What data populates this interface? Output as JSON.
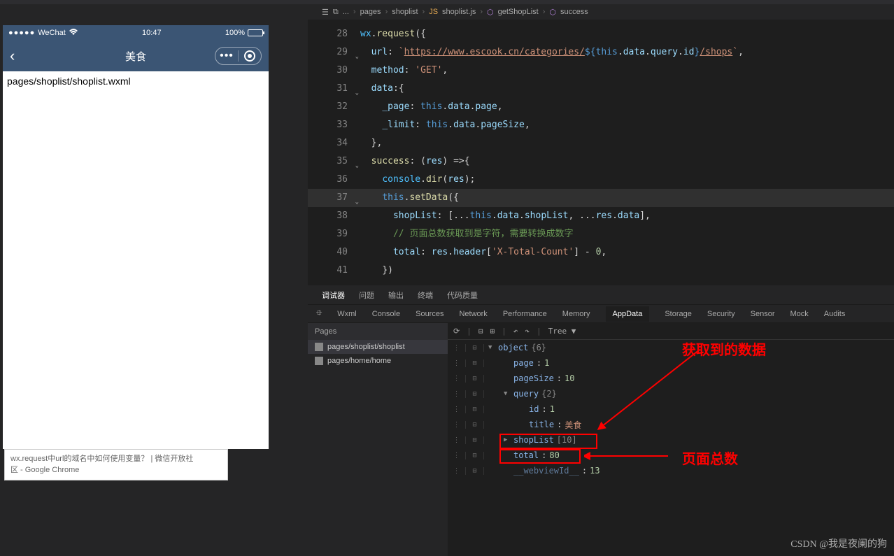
{
  "simulator": {
    "carrier_dots": "●●●●●",
    "carrier": "WeChat",
    "wifi_icon": "wifi",
    "time": "10:47",
    "battery_pct": "100%",
    "page_title": "美食",
    "body_text": "pages/shoplist/shoplist.wxml"
  },
  "browser_tab": {
    "line1": "wx.request中url的域名中如何使用变量？ | 微信开放社",
    "line2": "区 - Google Chrome"
  },
  "breadcrumb": {
    "items": [
      "...",
      "pages",
      "shoplist",
      "shoplist.js",
      "getShopList",
      "success"
    ]
  },
  "code_lines": [
    {
      "n": "28",
      "fold": "",
      "html": "<span class='tk-obj'>wx</span><span class='tk-punc'>.</span><span class='tk-fn'>request</span><span class='tk-punc'>({</span>"
    },
    {
      "n": "29",
      "fold": "v",
      "html": "  <span class='tk-prop'>url</span><span class='tk-punc'>: </span><span class='tk-str'>`</span><span class='tk-strlink'>https://www.escook.cn/categories/</span><span class='tk-tpl'>${</span><span class='tk-kw'>this</span><span class='tk-punc'>.</span><span class='tk-var'>data</span><span class='tk-punc'>.</span><span class='tk-var'>query</span><span class='tk-punc'>.</span><span class='tk-var'>id</span><span class='tk-tpl'>}</span><span class='tk-strlink'>/shops</span><span class='tk-str'>`</span><span class='tk-punc'>,</span>"
    },
    {
      "n": "30",
      "fold": "",
      "html": "  <span class='tk-prop'>method</span><span class='tk-punc'>: </span><span class='tk-str'>'GET'</span><span class='tk-punc'>,</span>"
    },
    {
      "n": "31",
      "fold": "v",
      "html": "  <span class='tk-prop'>data</span><span class='tk-punc'>:{</span>"
    },
    {
      "n": "32",
      "fold": "",
      "html": "    <span class='tk-prop'>_page</span><span class='tk-punc'>: </span><span class='tk-kw'>this</span><span class='tk-punc'>.</span><span class='tk-var'>data</span><span class='tk-punc'>.</span><span class='tk-var'>page</span><span class='tk-punc'>,</span>"
    },
    {
      "n": "33",
      "fold": "",
      "html": "    <span class='tk-prop'>_limit</span><span class='tk-punc'>: </span><span class='tk-kw'>this</span><span class='tk-punc'>.</span><span class='tk-var'>data</span><span class='tk-punc'>.</span><span class='tk-var'>pageSize</span><span class='tk-punc'>,</span>"
    },
    {
      "n": "34",
      "fold": "",
      "html": "  <span class='tk-punc'>},</span>"
    },
    {
      "n": "35",
      "fold": "v",
      "html": "  <span class='tk-fn'>success</span><span class='tk-punc'>: (</span><span class='tk-var'>res</span><span class='tk-punc'>) =>{</span>"
    },
    {
      "n": "36",
      "fold": "",
      "html": "    <span class='tk-obj'>console</span><span class='tk-punc'>.</span><span class='tk-fn'>dir</span><span class='tk-punc'>(</span><span class='tk-var'>res</span><span class='tk-punc'>);</span>"
    },
    {
      "n": "37",
      "fold": "v",
      "hl": true,
      "html": "    <span class='tk-kw'>this</span><span class='tk-punc'>.</span><span class='tk-fn'>setData</span><span class='tk-punc'>({</span>"
    },
    {
      "n": "38",
      "fold": "",
      "html": "      <span class='tk-prop'>shopList</span><span class='tk-punc'>: [...</span><span class='tk-kw'>this</span><span class='tk-punc'>.</span><span class='tk-var'>data</span><span class='tk-punc'>.</span><span class='tk-var'>shopList</span><span class='tk-punc'>, ...</span><span class='tk-var'>res</span><span class='tk-punc'>.</span><span class='tk-var'>data</span><span class='tk-punc'>],</span>"
    },
    {
      "n": "39",
      "fold": "",
      "html": "      <span class='tk-cmt'>// 页面总数获取到是字符，需要转换成数字</span>"
    },
    {
      "n": "40",
      "fold": "",
      "html": "      <span class='tk-prop'>total</span><span class='tk-punc'>: </span><span class='tk-var'>res</span><span class='tk-punc'>.</span><span class='tk-var'>header</span><span class='tk-punc'>[</span><span class='tk-str'>'X-Total-Count'</span><span class='tk-punc'>] - </span><span class='tk-num'>0</span><span class='tk-punc'>,</span>"
    },
    {
      "n": "41",
      "fold": "",
      "html": "    <span class='tk-punc'>})</span>"
    }
  ],
  "panel_tabs": [
    "调试器",
    "问题",
    "输出",
    "终端",
    "代码质量"
  ],
  "dev_tabs": [
    "Wxml",
    "Console",
    "Sources",
    "Network",
    "Performance",
    "Memory",
    "AppData",
    "Storage",
    "Security",
    "Sensor",
    "Mock",
    "Audits"
  ],
  "dev_tab_active": 6,
  "pages": {
    "header": "Pages",
    "items": [
      "pages/shoplist/shoplist",
      "pages/home/home"
    ],
    "selected": 0
  },
  "appdata_toolbar": {
    "mode": "Tree",
    "dropdown": "▼"
  },
  "appdata_tree": [
    {
      "indent": 0,
      "arrow": "▼",
      "key": "object",
      "bracket": "{6}"
    },
    {
      "indent": 1,
      "arrow": "",
      "key": "page",
      "sep": " : ",
      "num": "1"
    },
    {
      "indent": 1,
      "arrow": "",
      "key": "pageSize",
      "sep": " : ",
      "num": "10"
    },
    {
      "indent": 1,
      "arrow": "▼",
      "key": "query",
      "bracket": " {2}"
    },
    {
      "indent": 2,
      "arrow": "",
      "key": "id",
      "sep": " : ",
      "num": "1"
    },
    {
      "indent": 2,
      "arrow": "",
      "key": "title",
      "sep": " : ",
      "str": "美食"
    },
    {
      "indent": 1,
      "arrow": "▶",
      "key": "shopList",
      "bracket": " [10]"
    },
    {
      "indent": 1,
      "arrow": "",
      "key": "total",
      "sep": " : ",
      "num": "80"
    },
    {
      "indent": 1,
      "arrow": "",
      "key": "__webviewId__",
      "sep": " : ",
      "num": "13",
      "dim": true
    }
  ],
  "annotations": {
    "label1": "获取到的数据",
    "label2": "页面总数"
  },
  "watermark": "CSDN @我是夜阑的狗"
}
